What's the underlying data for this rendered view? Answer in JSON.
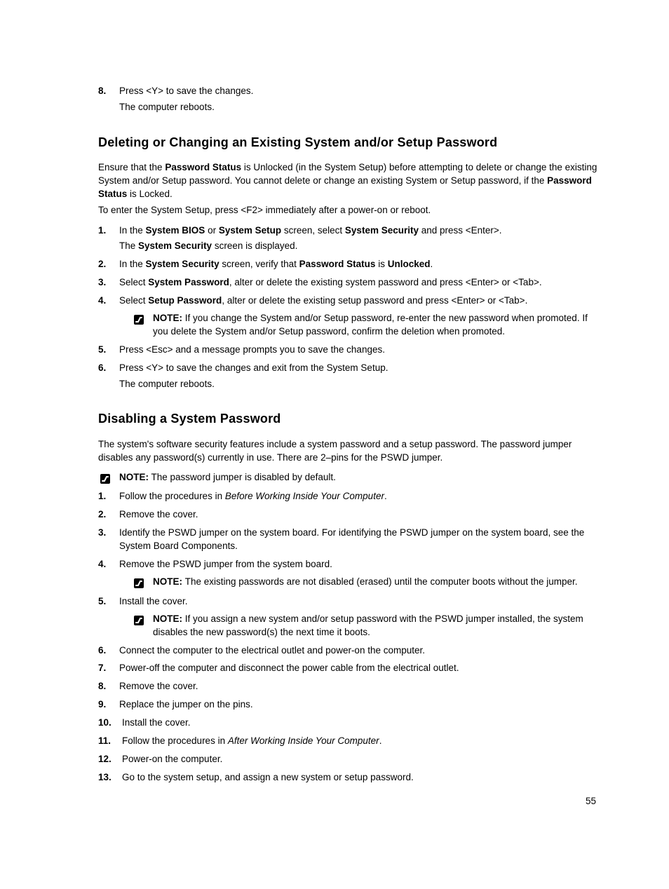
{
  "page_number": "55",
  "top_steps": [
    {
      "num": "8.",
      "text": "Press <Y> to save the changes.",
      "sub": "The computer reboots."
    }
  ],
  "section1": {
    "heading": "Deleting or Changing an Existing System and/or Setup Password",
    "intro_html": "Ensure that the <b>Password Status</b> is Unlocked (in the System Setup) before attempting to delete or change the existing System and/or Setup password. You cannot delete or change an existing System or Setup password, if the <b>Password Status</b> is Locked.",
    "intro2": "To enter the System Setup, press <F2> immediately after a power-on or reboot.",
    "steps": [
      {
        "html": "In the <b>System BIOS</b> or <b>System Setup</b> screen, select <b>System Security</b> and press &lt;Enter&gt;.",
        "sub_html": "The <b>System Security</b> screen is displayed."
      },
      {
        "html": "In the <b>System Security</b> screen, verify that <b>Password Status</b> is <b>Unlocked</b>."
      },
      {
        "html": "Select <b>System Password</b>, alter or delete the existing system password and press &lt;Enter&gt; or &lt;Tab&gt;."
      },
      {
        "html": "Select <b>Setup Password</b>, alter or delete the existing setup password and press &lt;Enter&gt; or &lt;Tab&gt;.",
        "note": {
          "label": "NOTE:",
          "text": "If you change the System and/or Setup password, re-enter the new password when promoted. If you delete the System and/or Setup password, confirm the deletion when promoted."
        }
      },
      {
        "html": "Press &lt;Esc&gt; and a message prompts you to save the changes."
      },
      {
        "html": "Press &lt;Y&gt; to save the changes and exit from the System Setup.",
        "sub_html": "The computer reboots."
      }
    ]
  },
  "section2": {
    "heading": "Disabling a System Password",
    "intro": "The system's software security features include a system password and a setup password. The password jumper disables any password(s) currently in use. There are 2–pins for the PSWD jumper.",
    "top_note": {
      "label": "NOTE:",
      "text": "The password jumper is disabled by default."
    },
    "steps": [
      {
        "html": "Follow the procedures in <i>Before Working Inside Your Computer</i>."
      },
      {
        "html": "Remove the cover."
      },
      {
        "html": "Identify the PSWD jumper on the system board. For identifying the PSWD jumper on the system board, see the System Board Components."
      },
      {
        "html": "Remove the PSWD jumper from the system board.",
        "note": {
          "label": "NOTE:",
          "text": "The existing passwords are not disabled (erased) until the computer boots without the jumper."
        }
      },
      {
        "html": "Install the cover.",
        "note": {
          "label": "NOTE:",
          "text": "If you assign a new system and/or setup password with the PSWD jumper installed, the system disables the new password(s) the next time it boots."
        }
      },
      {
        "html": "Connect the computer to the electrical outlet and power-on the computer."
      },
      {
        "html": "Power-off the computer and disconnect the power cable from the electrical outlet."
      },
      {
        "html": "Remove the cover."
      },
      {
        "html": "Replace the jumper on the pins."
      },
      {
        "html": "Install the cover."
      },
      {
        "html": "Follow the procedures in <i>After Working Inside Your Computer</i>."
      },
      {
        "html": "Power-on the computer."
      },
      {
        "html": "Go to the system setup, and assign a new system or setup password."
      }
    ]
  }
}
